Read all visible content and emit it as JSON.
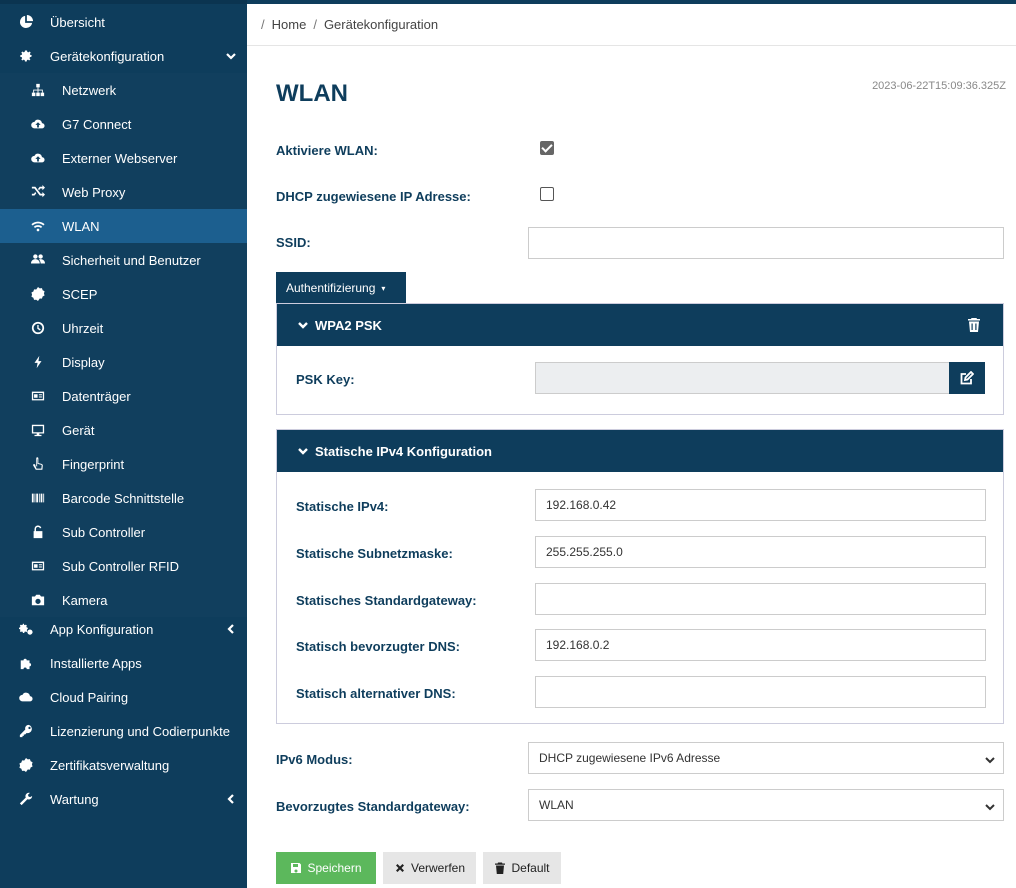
{
  "sidebar": {
    "items": [
      {
        "label": "Übersicht",
        "icon": "pie-chart-icon"
      },
      {
        "label": "Gerätekonfiguration",
        "icon": "gear-icon",
        "expanded": true
      },
      {
        "label": "Netzwerk",
        "icon": "sitemap-icon"
      },
      {
        "label": "G7 Connect",
        "icon": "cloud-upload-icon"
      },
      {
        "label": "Externer Webserver",
        "icon": "cloud-upload-icon"
      },
      {
        "label": "Web Proxy",
        "icon": "random-icon"
      },
      {
        "label": "WLAN",
        "icon": "wifi-icon",
        "active": true
      },
      {
        "label": "Sicherheit und Benutzer",
        "icon": "users-icon"
      },
      {
        "label": "SCEP",
        "icon": "certificate-icon"
      },
      {
        "label": "Uhrzeit",
        "icon": "clock-icon"
      },
      {
        "label": "Display",
        "icon": "bolt-icon"
      },
      {
        "label": "Datenträger",
        "icon": "id-card-icon"
      },
      {
        "label": "Gerät",
        "icon": "desktop-icon"
      },
      {
        "label": "Fingerprint",
        "icon": "hand-pointer-icon"
      },
      {
        "label": "Barcode Schnittstelle",
        "icon": "barcode-icon"
      },
      {
        "label": "Sub Controller",
        "icon": "unlock-icon"
      },
      {
        "label": "Sub Controller RFID",
        "icon": "id-card-icon"
      },
      {
        "label": "Kamera",
        "icon": "camera-icon"
      },
      {
        "label": "App Konfiguration",
        "icon": "cogs-icon"
      },
      {
        "label": "Installierte Apps",
        "icon": "puzzle-icon"
      },
      {
        "label": "Cloud Pairing",
        "icon": "cloud-icon"
      },
      {
        "label": "Lizenzierung und Codierpunkte",
        "icon": "key-icon"
      },
      {
        "label": "Zertifikatsverwaltung",
        "icon": "certificate-icon"
      },
      {
        "label": "Wartung",
        "icon": "wrench-icon"
      }
    ]
  },
  "breadcrumb": {
    "home": "Home",
    "current": "Gerätekonfiguration",
    "separator": "/"
  },
  "page": {
    "title": "WLAN",
    "timestamp": "2023-06-22T15:09:36.325Z"
  },
  "form": {
    "activate_wlan": {
      "label": "Aktiviere WLAN:",
      "checked": true
    },
    "dhcp": {
      "label": "DHCP zugewiesene IP Adresse:",
      "checked": false
    },
    "ssid": {
      "label": "SSID:",
      "value": ""
    },
    "auth_dropdown": {
      "label": "Authentifizierung",
      "caret": "▾"
    },
    "wpa2": {
      "title": "WPA2 PSK",
      "psk_label": "PSK Key:",
      "psk_value": ""
    },
    "ipv4": {
      "title": "Statische IPv4 Konfiguration",
      "fields": [
        {
          "label": "Statische IPv4:",
          "value": "192.168.0.42"
        },
        {
          "label": "Statische Subnetzmaske:",
          "value": "255.255.255.0"
        },
        {
          "label": "Statisches Standardgateway:",
          "value": ""
        },
        {
          "label": "Statisch bevorzugter DNS:",
          "value": "192.168.0.2"
        },
        {
          "label": "Statisch alternativer DNS:",
          "value": ""
        }
      ]
    },
    "ipv6": {
      "label": "IPv6 Modus:",
      "value": "DHCP zugewiesene IPv6 Adresse"
    },
    "gateway": {
      "label": "Bevorzugtes Standardgateway:",
      "value": "WLAN"
    }
  },
  "actions": {
    "save": "Speichern",
    "discard": "Verwerfen",
    "default": "Default"
  },
  "colors": {
    "sidebar": "#0e3d5c",
    "active": "#1c5f8f",
    "save": "#5cb85c"
  }
}
